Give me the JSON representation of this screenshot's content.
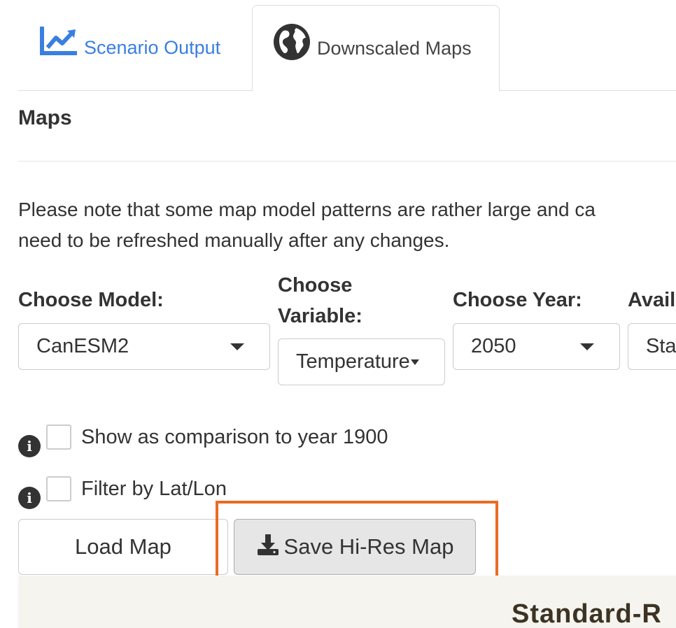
{
  "tabs": [
    {
      "label": "Scenario Output",
      "icon": "chart-line-icon",
      "active": false
    },
    {
      "label": "Downscaled Maps",
      "icon": "globe-icon",
      "active": true
    }
  ],
  "section": {
    "title": "Maps"
  },
  "note": {
    "line1": "Please note that some map model patterns are rather large and ca",
    "line2": "need to be refreshed manually after any changes."
  },
  "controls": {
    "model": {
      "label": "Choose Model:",
      "value": "CanESM2"
    },
    "variable": {
      "label_line1": "Choose",
      "label_line2": "Variable:",
      "value": "Temperature"
    },
    "year": {
      "label": "Choose Year:",
      "value": "2050"
    },
    "available": {
      "label": "Avail",
      "value": "Sta"
    }
  },
  "checkboxes": [
    {
      "label": "Show as comparison to year 1900",
      "checked": false
    },
    {
      "label": "Filter by Lat/Lon",
      "checked": false
    }
  ],
  "buttons": {
    "load": "Load Map",
    "save": "Save Hi-Res Map"
  },
  "panel": {
    "title": "Standard-R"
  },
  "colors": {
    "link_blue": "#3a7fe0",
    "highlight_orange": "#ec6a24",
    "panel_bg": "#f5f4ef"
  }
}
